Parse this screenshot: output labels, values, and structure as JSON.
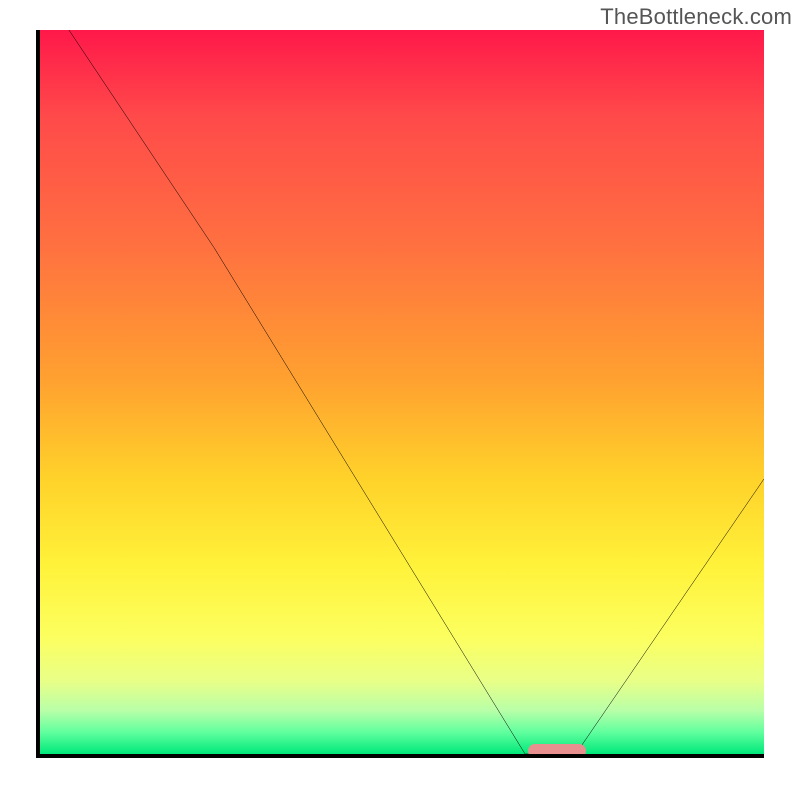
{
  "watermark": "TheBottleneck.com",
  "chart_data": {
    "type": "line",
    "title": "",
    "xlabel": "",
    "ylabel": "",
    "xlim": [
      0,
      100
    ],
    "ylim": [
      0,
      100
    ],
    "grid": false,
    "legend": false,
    "background_gradient": {
      "direction": "vertical",
      "stops": [
        {
          "pos": 0,
          "color": "#ff184a"
        },
        {
          "pos": 12,
          "color": "#ff4a4a"
        },
        {
          "pos": 30,
          "color": "#ff7140"
        },
        {
          "pos": 48,
          "color": "#ffa030"
        },
        {
          "pos": 62,
          "color": "#ffd22a"
        },
        {
          "pos": 74,
          "color": "#fff23a"
        },
        {
          "pos": 84,
          "color": "#fcff60"
        },
        {
          "pos": 90,
          "color": "#e8ff88"
        },
        {
          "pos": 94,
          "color": "#b8ffa8"
        },
        {
          "pos": 97,
          "color": "#60ff9e"
        },
        {
          "pos": 100,
          "color": "#00e87a"
        }
      ]
    },
    "series": [
      {
        "name": "bottleneck-curve",
        "color": "#000000",
        "x": [
          4,
          24,
          67,
          74,
          100
        ],
        "y": [
          100,
          70,
          0,
          0,
          38
        ]
      }
    ],
    "marker": {
      "name": "optimal-range",
      "shape": "rounded-rect",
      "color": "#e89090",
      "x": 71,
      "y": 1
    }
  }
}
